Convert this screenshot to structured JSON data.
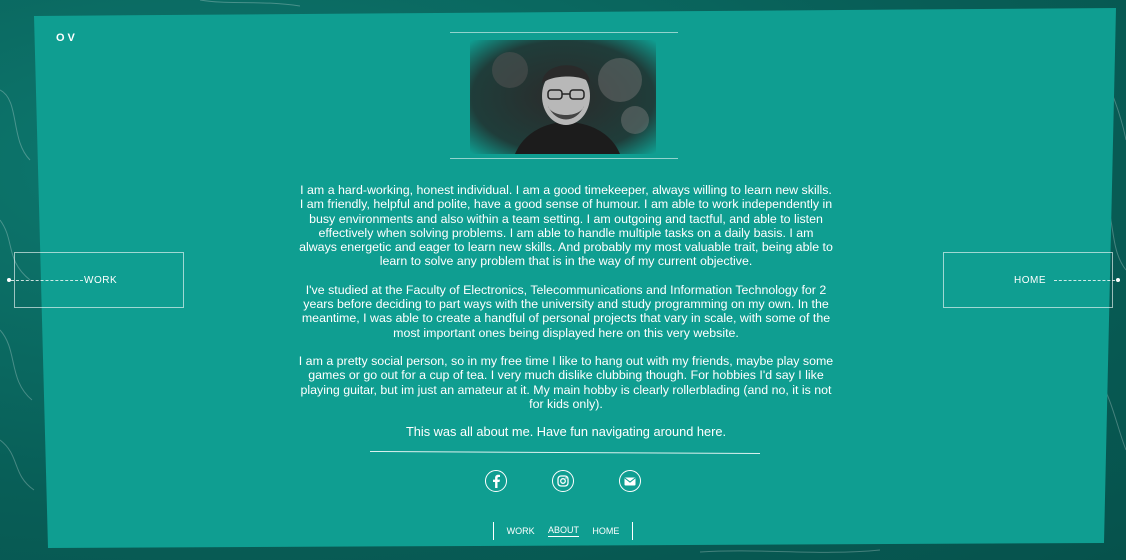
{
  "brand": {
    "logo_text": "OV"
  },
  "profile": {
    "photo_alt": "Portrait photo"
  },
  "about": {
    "paragraphs": [
      "I am a hard-working, honest individual. I am a good timekeeper, always willing to learn new skills. I am friendly, helpful and polite, have a good sense of humour. I am able to work independently in busy environments and also within a team setting. I am outgoing and tactful, and able to listen effectively when solving problems. I am able to handle multiple tasks on a daily basis. I am always energetic and eager to learn new skills. And probably my most valuable trait, being able to learn to solve any problem that is in the way of my current objective.",
      "I've studied at the Faculty of Electronics, Telecommunications and Information Technology for 2 years before deciding to part ways with the university and study programming on my own. In the meantime, I was able to create a handful of personal projects that vary in scale, with some of the most important ones being displayed here on this very website.",
      "I am a pretty social person, so in my free time I like to hang out with my friends, maybe play some games or go out for a cup of tea. I very much dislike clubbing though. For hobbies I'd say I like playing guitar, but im just an amateur at it. My main hobby is clearly rollerblading (and no, it is not for kids only)."
    ],
    "closing": "This was all about me. Have fun navigating around here."
  },
  "social": {
    "icons": [
      "facebook-icon",
      "instagram-icon",
      "email-icon"
    ]
  },
  "side_nav": {
    "left_label": "WORK",
    "right_label": "HOME"
  },
  "bottom_nav": {
    "items": [
      {
        "label": "WORK",
        "active": false
      },
      {
        "label": "ABOUT",
        "active": true
      },
      {
        "label": "HOME",
        "active": false
      }
    ]
  },
  "colors": {
    "panel": "#0f9e91",
    "background": "#0b6a62",
    "text": "#ffffff"
  }
}
